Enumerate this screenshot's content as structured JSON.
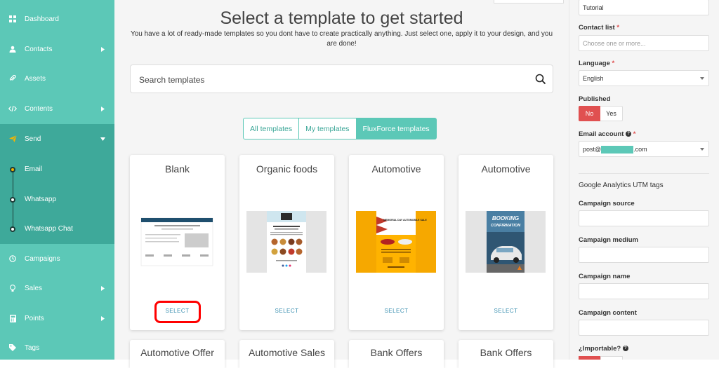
{
  "sidebar": {
    "items": [
      {
        "label": "Dashboard",
        "icon": "dashboard-icon"
      },
      {
        "label": "Contacts",
        "icon": "user-icon"
      },
      {
        "label": "Assets",
        "icon": "paperclip-icon"
      },
      {
        "label": "Contents",
        "icon": "code-icon"
      },
      {
        "label": "Send",
        "icon": "paper-plane-icon"
      },
      {
        "label": "Campaigns",
        "icon": "clock-icon"
      },
      {
        "label": "Sales",
        "icon": "bulb-icon"
      },
      {
        "label": "Points",
        "icon": "calculator-icon"
      },
      {
        "label": "Tags",
        "icon": "tag-icon"
      }
    ],
    "send_subitems": [
      {
        "label": "Email",
        "active": true
      },
      {
        "label": "Whatsapp",
        "active": false
      },
      {
        "label": "Whatsapp Chat",
        "active": false
      }
    ]
  },
  "main": {
    "title": "Select a template to get started",
    "subtitle": "You have a lot of ready-made templates so you dont have to create practically anything. Just select one, apply it to your design, and you are done!",
    "search_placeholder": "Search templates",
    "tabs": [
      {
        "label": "All templates",
        "active": false
      },
      {
        "label": "My templates",
        "active": false
      },
      {
        "label": "FluxForce templates",
        "active": true
      }
    ],
    "cards": [
      {
        "title": "Blank",
        "select": "SELECT"
      },
      {
        "title": "Organic foods",
        "select": "SELECT"
      },
      {
        "title": "Automotive",
        "select": "SELECT"
      },
      {
        "title": "Automotive",
        "select": "SELECT"
      }
    ],
    "cards_row2": [
      {
        "title": "Automotive Offer"
      },
      {
        "title": "Automotive Sales"
      },
      {
        "title": "Bank Offers"
      },
      {
        "title": "Bank Offers"
      }
    ],
    "thumb_texts": {
      "automotive_1": "MEMORIAL DAY AUTOMOBILE SALE",
      "automotive_2_line1": "BOOKING",
      "automotive_2_line2": "CONFIRMATION"
    }
  },
  "panel": {
    "tutorial_value": "Tutorial",
    "contact_list_label": "Contact list",
    "contact_list_placeholder": "Choose one or more...",
    "language_label": "Language",
    "language_value": "English",
    "published_label": "Published",
    "published_no": "No",
    "published_yes": "Yes",
    "email_account_label": "Email account",
    "email_prefix": "post@",
    "email_suffix": ".com",
    "ga_title": "Google Analytics UTM tags",
    "campaign_source_label": "Campaign source",
    "campaign_medium_label": "Campaign medium",
    "campaign_name_label": "Campaign name",
    "campaign_content_label": "Campaign content",
    "importable_label": "¿Importable?",
    "required_mark": "*",
    "help_mark": "?"
  },
  "colors": {
    "sidebar": "#5cc8b7",
    "sidebar_dark": "#3ea99a",
    "accent": "#5cc8b7",
    "danger": "#e05050",
    "highlight_ring": "#ff0000"
  }
}
